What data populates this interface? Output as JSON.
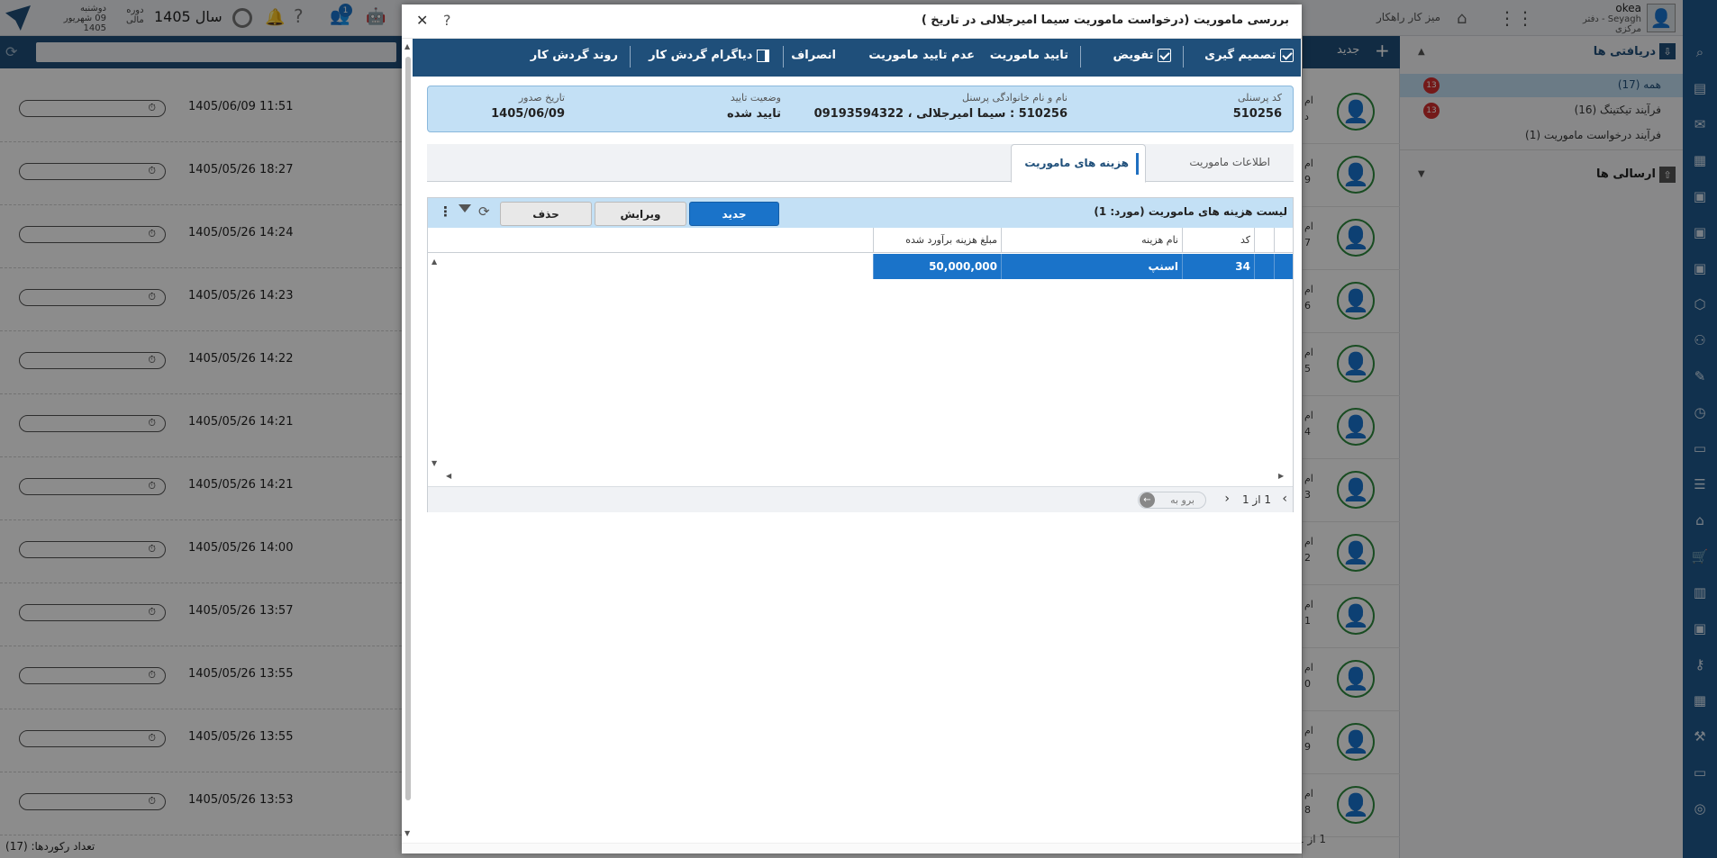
{
  "app": {
    "user_name": "okea",
    "user_org": "Seyagh - دفتر مرکزی",
    "workspace_label": "میز کار راهکار",
    "year_label": "سال 1405",
    "period_line1": "دوره",
    "period_line2": "مالی",
    "day_name": "دوشنبه",
    "date_text": "09 شهریور 1405",
    "notif_count": "1",
    "new_label": "جدید",
    "record_count": "تعداد رکوردها: (17)",
    "pager_text": "1  از  1"
  },
  "side_panel": {
    "inbox_label": "دریافتی ها",
    "sent_label": "ارسالی ها",
    "items": [
      {
        "label": "همه (17)",
        "badge": "13"
      },
      {
        "label": "فرآیند تیکتینگ (16)",
        "badge": "13"
      },
      {
        "label": "فرآیند درخواست ماموریت (1)",
        "badge": ""
      }
    ]
  },
  "list_rows": [
    {
      "date": "1405/06/09",
      "time": "11:51",
      "side": "د",
      "tag": "ام"
    },
    {
      "date": "1405/05/26",
      "time": "18:27",
      "side": "9",
      "tag": "ام"
    },
    {
      "date": "1405/05/26",
      "time": "14:24",
      "side": "7",
      "tag": "ام"
    },
    {
      "date": "1405/05/26",
      "time": "14:23",
      "side": "6",
      "tag": "ام"
    },
    {
      "date": "1405/05/26",
      "time": "14:22",
      "side": "5",
      "tag": "ام"
    },
    {
      "date": "1405/05/26",
      "time": "14:21",
      "side": "4",
      "tag": "ام"
    },
    {
      "date": "1405/05/26",
      "time": "14:21",
      "side": "3",
      "tag": "ام"
    },
    {
      "date": "1405/05/26",
      "time": "14:00",
      "side": "2",
      "tag": "ام"
    },
    {
      "date": "1405/05/26",
      "time": "13:57",
      "side": "1",
      "tag": "ام"
    },
    {
      "date": "1405/05/26",
      "time": "13:55",
      "side": "0",
      "tag": "ام"
    },
    {
      "date": "1405/05/26",
      "time": "13:55",
      "side": "9",
      "tag": "ام"
    },
    {
      "date": "1405/05/26",
      "time": "13:53",
      "side": "8",
      "tag": "ام"
    }
  ],
  "modal": {
    "title": "بررسی ماموریت (درخواست ماموریت سیما امیرجلالی در تاریخ )",
    "help": "?",
    "close": "✕",
    "toolbar": {
      "decide": "تصمیم گیری",
      "delegate": "تفویض",
      "approve": "تایید ماموریت",
      "reject": "عدم تایید ماموریت",
      "cancel": "انصراف",
      "diagram": "دیاگرام گردش کار",
      "workflow": "روند گردش کار"
    },
    "info": {
      "code_label": "کد پرسنلی",
      "code_value": "510256",
      "name_label": "نام و نام خانوادگی پرسنل",
      "name_value": "510256 : سیما امیرجلالی ، 09193594322",
      "status_label": "وضعیت تایید",
      "status_value": "تایید شده",
      "date_label": "تاریخ صدور",
      "date_value": "1405/06/09"
    },
    "tabs": {
      "costs": "هزینه های ماموریت",
      "info": "اطلاعات ماموریت"
    },
    "grid": {
      "title": "لیست هزینه های ماموریت (مورد: 1)",
      "btn_new": "جدید",
      "btn_edit": "ویرایش",
      "btn_delete": "حذف",
      "columns": [
        "کد",
        "نام هزینه",
        "مبلغ هزینه برآورد شده"
      ],
      "rows": [
        {
          "code": "34",
          "name": "اسنپ",
          "amount": "50,000,000"
        }
      ],
      "pager_text": "1  از  1",
      "goto_label": "برو به"
    }
  },
  "colors": {
    "primary": "#1f4f7a",
    "accent": "#1a73c9",
    "info_bg": "#c3e0f5",
    "badge": "#d32f2f"
  }
}
